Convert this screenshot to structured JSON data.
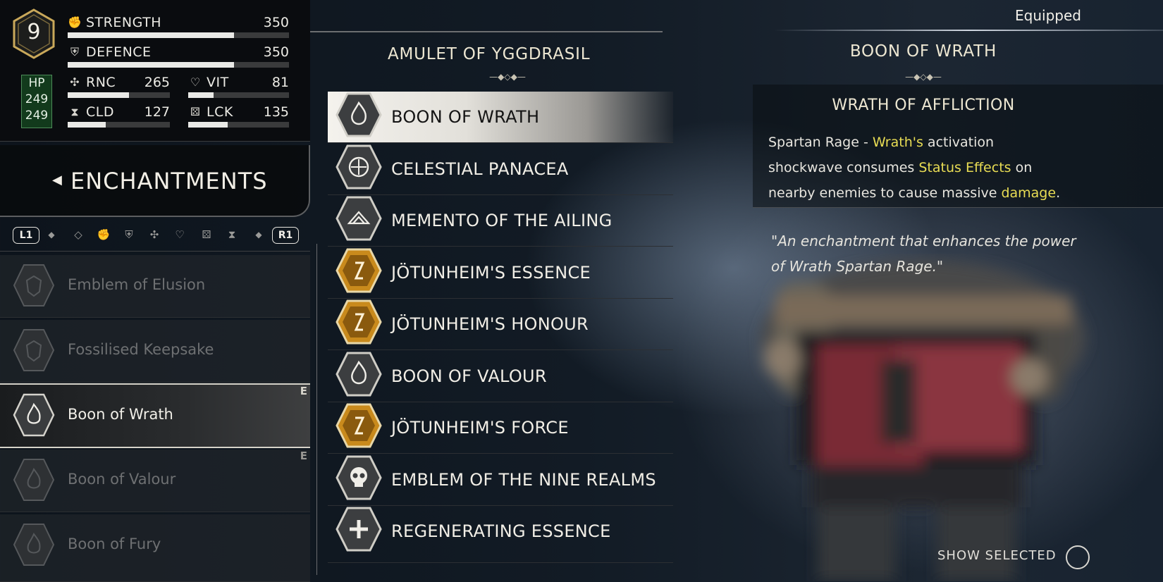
{
  "player": {
    "level": "9",
    "hp_label": "HP",
    "hp_current": "249",
    "hp_max": "249"
  },
  "stats": [
    {
      "name": "STRENGTH",
      "value": "350",
      "icon": "fist-icon",
      "fill": 0.75
    },
    {
      "name": "DEFENCE",
      "value": "350",
      "icon": "shield-icon",
      "fill": 0.75
    },
    {
      "name": "RNC",
      "value": "265",
      "icon": "runic-icon",
      "fill": 0.6
    },
    {
      "name": "VIT",
      "value": "81",
      "icon": "heart-icon",
      "fill": 0.25
    },
    {
      "name": "CLD",
      "value": "127",
      "icon": "hourglass-icon",
      "fill": 0.37
    },
    {
      "name": "LCK",
      "value": "135",
      "icon": "dice-icon",
      "fill": 0.39
    }
  ],
  "enchantments": {
    "title": "ENCHANTMENTS",
    "l1": "L1",
    "r1": "R1",
    "filter_icons": [
      "diamond-icon",
      "fist-icon",
      "shield-icon",
      "runic-icon",
      "heart-icon",
      "dice-icon",
      "hourglass-icon"
    ],
    "items": [
      {
        "name": "Emblem of Elusion",
        "equipped": ""
      },
      {
        "name": "Fossilised Keepsake",
        "equipped": ""
      },
      {
        "name": "Boon of Wrath",
        "equipped": "E"
      },
      {
        "name": "Boon of Valour",
        "equipped": "E"
      },
      {
        "name": "Boon of Fury",
        "equipped": ""
      }
    ]
  },
  "amulet": {
    "title": "AMULET OF YGGDRASIL",
    "slots": [
      {
        "name": "BOON OF WRATH",
        "icon": "flame-rune-icon",
        "gold": false
      },
      {
        "name": "CELESTIAL PANACEA",
        "icon": "celestial-icon",
        "gold": false
      },
      {
        "name": "MEMENTO OF THE AILING",
        "icon": "memento-icon",
        "gold": false
      },
      {
        "name": "JÖTUNHEIM'S ESSENCE",
        "icon": "jotunheim-rune-icon",
        "gold": true
      },
      {
        "name": "JÖTUNHEIM'S HONOUR",
        "icon": "jotunheim-rune-icon",
        "gold": true
      },
      {
        "name": "BOON OF VALOUR",
        "icon": "flame-rune-icon",
        "gold": false
      },
      {
        "name": "JÖTUNHEIM'S FORCE",
        "icon": "jotunheim-rune-icon",
        "gold": true
      },
      {
        "name": "EMBLEM OF THE NINE REALMS",
        "icon": "skull-icon",
        "gold": false
      },
      {
        "name": "REGENERATING ESSENCE",
        "icon": "cross-icon",
        "gold": false
      }
    ]
  },
  "detail": {
    "equipped_label": "Equipped",
    "title": "BOON OF WRATH",
    "perk": "WRATH OF AFFLICTION",
    "desc_1": "Spartan Rage - ",
    "desc_2": "Wrath's",
    "desc_3": " activation",
    "desc_4": "shockwave consumes ",
    "desc_5": "Status Effects",
    "desc_6": " on",
    "desc_7": "nearby enemies to cause massive ",
    "desc_8": "damage",
    "desc_9": ".",
    "quote": "\"An enchantment that enhances the power of Wrath Spartan Rage.\"",
    "show_selected": "SHOW SELECTED",
    "highlight_color": "#e9dd54"
  }
}
